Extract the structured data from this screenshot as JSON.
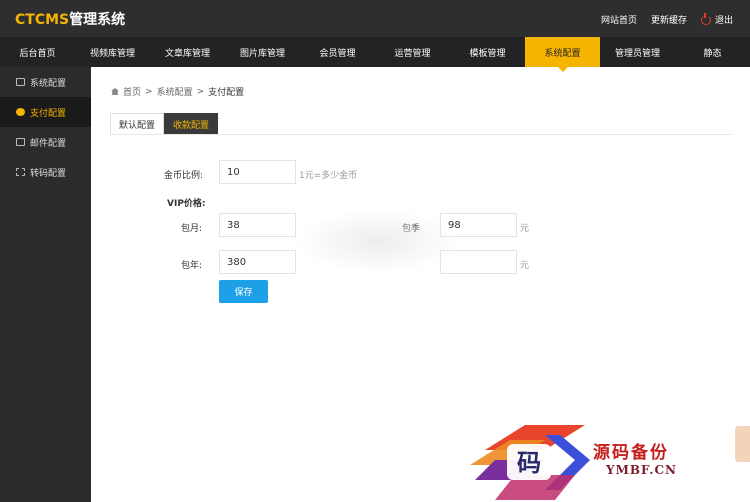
{
  "app": {
    "logo_brand": "CTCMS",
    "logo_rest": "管理系统"
  },
  "header": {
    "links": [
      {
        "label": "网站首页"
      },
      {
        "label": "更新缓存"
      },
      {
        "label": "退出"
      }
    ]
  },
  "mainnav": {
    "items": [
      {
        "label": "后台首页"
      },
      {
        "label": "视频库管理"
      },
      {
        "label": "文章库管理"
      },
      {
        "label": "图片库管理"
      },
      {
        "label": "会员管理"
      },
      {
        "label": "运营管理"
      },
      {
        "label": "模板管理"
      },
      {
        "label": "系统配置"
      },
      {
        "label": "管理员管理"
      },
      {
        "label": "静态"
      }
    ],
    "active_index": 7
  },
  "sidebar": {
    "items": [
      {
        "label": "系统配置",
        "icon": "monitor-icon"
      },
      {
        "label": "支付配置",
        "icon": "payment-icon"
      },
      {
        "label": "邮件配置",
        "icon": "mail-icon"
      },
      {
        "label": "转码配置",
        "icon": "grid-icon"
      }
    ],
    "active_index": 1
  },
  "breadcrumb": {
    "home": "首页",
    "sep": ">",
    "parent": "系统配置",
    "current": "支付配置"
  },
  "tabs": [
    {
      "label": "默认配置"
    },
    {
      "label": "收款配置"
    }
  ],
  "form": {
    "coin_ratio_label": "金币比例:",
    "coin_ratio_value": "10",
    "coin_ratio_hint": "1元=多少金币",
    "vip_title": "VIP价格:",
    "monthly_label": "包月:",
    "monthly_value": "38",
    "quarterly_label": "包季",
    "quarterly_value": "98",
    "quarterly_unit": "元",
    "yearly_label": "包年:",
    "yearly_value": "380",
    "extra_value": "",
    "extra_unit": "元",
    "save_label": "保存"
  },
  "watermark": {
    "char": "码",
    "title": "源码备份",
    "subtitle": "YMBF.CN"
  },
  "colors": {
    "accent": "#f5b400",
    "topbar": "#2e2e2e",
    "nav": "#232323",
    "sidebar": "#2b2b2b",
    "button": "#1ea0e8"
  }
}
